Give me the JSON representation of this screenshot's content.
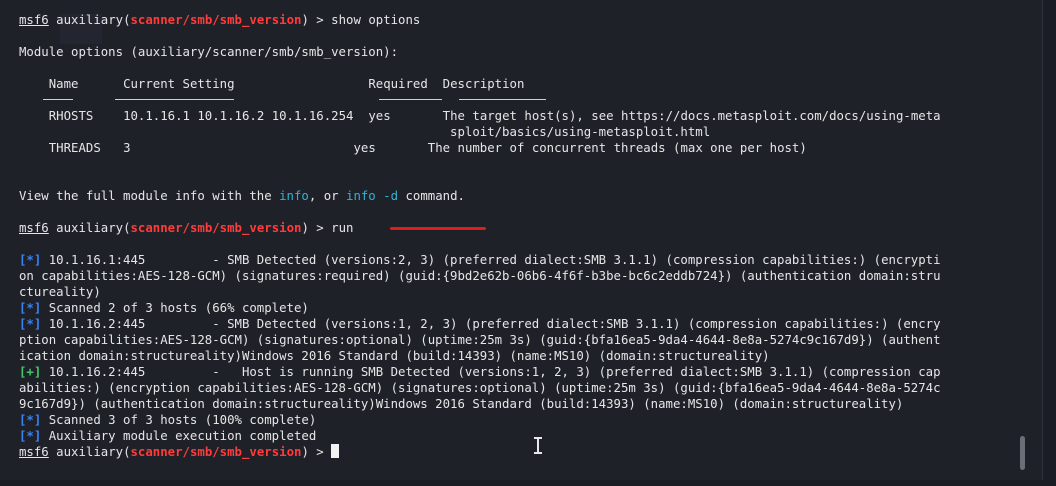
{
  "prompt": {
    "host": "msf6",
    "context": "auxiliary",
    "module": "scanner/smb/smb_version",
    "open": "(",
    "close": ")",
    "arrow": " > "
  },
  "commands": {
    "show": "show options",
    "run": "run"
  },
  "options": {
    "title": "Module options (auxiliary/scanner/smb/smb_version):",
    "headers": {
      "name": "Name",
      "setting": "Current Setting",
      "required": "Required",
      "description": "Description"
    },
    "rows": [
      {
        "name": "RHOSTS",
        "setting": "10.1.16.1 10.1.16.2 10.1.16.254",
        "required": "yes",
        "description": "The target host(s), see https://docs.metasploit.com/docs/using-meta",
        "description_cont": "sploit/basics/using-metasploit.html"
      },
      {
        "name": "THREADS",
        "setting": "3",
        "required": "yes",
        "description": "The number of concurrent threads (max one per host)"
      }
    ]
  },
  "info_line": {
    "prefix": "View the full module info with the ",
    "cmd1": "info",
    "middle": ", or ",
    "cmd2": "info -d",
    "suffix": " command."
  },
  "output": [
    {
      "tag": "[*]",
      "kind": "info",
      "lines": [
        " 10.1.16.1:445         - SMB Detected (versions:2, 3) (preferred dialect:SMB 3.1.1) (compression capabilities:) (encrypti",
        "on capabilities:AES-128-GCM) (signatures:required) (guid:{9bd2e62b-06b6-4f6f-b3be-bc6c2eddb724}) (authentication domain:stru",
        "ctureality)"
      ]
    },
    {
      "tag": "[*]",
      "kind": "info",
      "lines": [
        " Scanned 2 of 3 hosts (66% complete)"
      ]
    },
    {
      "tag": "[*]",
      "kind": "info",
      "lines": [
        " 10.1.16.2:445         - SMB Detected (versions:1, 2, 3) (preferred dialect:SMB 3.1.1) (compression capabilities:) (encry",
        "ption capabilities:AES-128-GCM) (signatures:optional) (uptime:25m 3s) (guid:{bfa16ea5-9da4-4644-8e8a-5274c9c167d9}) (authent",
        "ication domain:structureality)Windows 2016 Standard (build:14393) (name:MS10) (domain:structureality)"
      ]
    },
    {
      "tag": "[+]",
      "kind": "good",
      "lines": [
        " 10.1.16.2:445         -   Host is running SMB Detected (versions:1, 2, 3) (preferred dialect:SMB 3.1.1) (compression cap",
        "abilities:) (encryption capabilities:AES-128-GCM) (signatures:optional) (uptime:25m 3s) (guid:{bfa16ea5-9da4-4644-8e8a-5274c",
        "9c167d9}) (authentication domain:structureality)Windows 2016 Standard (build:14393) (name:MS10) (domain:structureality)"
      ]
    },
    {
      "tag": "[*]",
      "kind": "info",
      "lines": [
        " Scanned 3 of 3 hosts (100% complete)"
      ]
    },
    {
      "tag": "[*]",
      "kind": "info",
      "lines": [
        " Auxiliary module execution completed"
      ]
    }
  ],
  "colors": {
    "background": "#1f2129",
    "text": "#e6e6e6",
    "module": "#ff3b3b",
    "info_tag": "#3b82f6",
    "good_tag": "#44c767",
    "command_highlight": "#2fb4d6",
    "annotation": "#e31b1b"
  }
}
